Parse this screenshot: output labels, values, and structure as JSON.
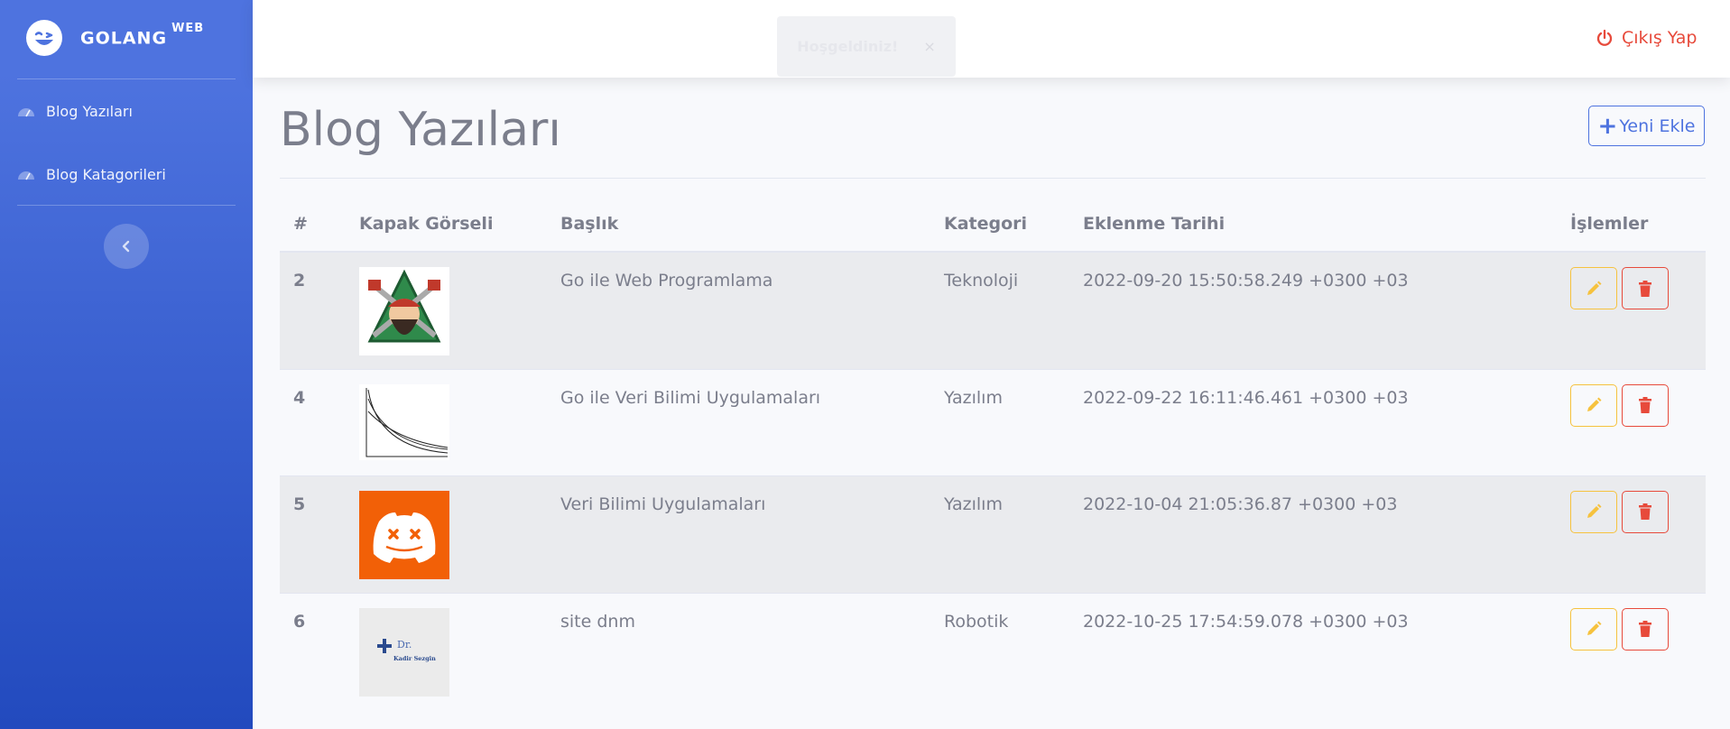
{
  "brand": {
    "name": "GOLANG",
    "suffix": "WEB"
  },
  "sidebar": {
    "items": [
      {
        "label": "Blog Yazıları",
        "icon": "dashboard-icon"
      },
      {
        "label": "Blog Katagorileri",
        "icon": "dashboard-icon"
      }
    ],
    "toggle_icon": "chevron-left-icon"
  },
  "topbar": {
    "toast": {
      "text": "Hoşgeldiniz!",
      "close": "×"
    },
    "logout_label": "Çıkış Yap"
  },
  "page": {
    "title": "Blog Yazıları",
    "add_label": "Yeni Ekle"
  },
  "table": {
    "headers": [
      "#",
      "Kapak Görseli",
      "Başlık",
      "Kategori",
      "Eklenme Tarihi",
      "İşlemler"
    ],
    "rows": [
      {
        "id": "2",
        "image": "lumberjack-mascot",
        "title": "Go ile Web Programlama",
        "category": "Teknoloji",
        "date": "2022-09-20 15:50:58.249 +0300 +03"
      },
      {
        "id": "4",
        "image": "decay-curves-plot",
        "title": "Go ile Veri Bilimi Uygulamaları",
        "category": "Yazılım",
        "date": "2022-09-22 16:11:46.461 +0300 +03"
      },
      {
        "id": "5",
        "image": "discord-logo",
        "title": "Veri Bilimi Uygulamaları",
        "category": "Yazılım",
        "date": "2022-10-04 21:05:36.87 +0300 +03"
      },
      {
        "id": "6",
        "image": "dr-kadir-sezgin-logo",
        "title": "site dnm",
        "category": "Robotik",
        "date": "2022-10-25 17:54:59.078 +0300 +03"
      }
    ]
  },
  "thumb_texts": {
    "dr": "Dr.",
    "name": "Kadir Sezgin"
  },
  "colors": {
    "primary": "#4e73df",
    "warning": "#f6c23e",
    "danger": "#e74a3b",
    "discord_bg": "#f26007"
  }
}
